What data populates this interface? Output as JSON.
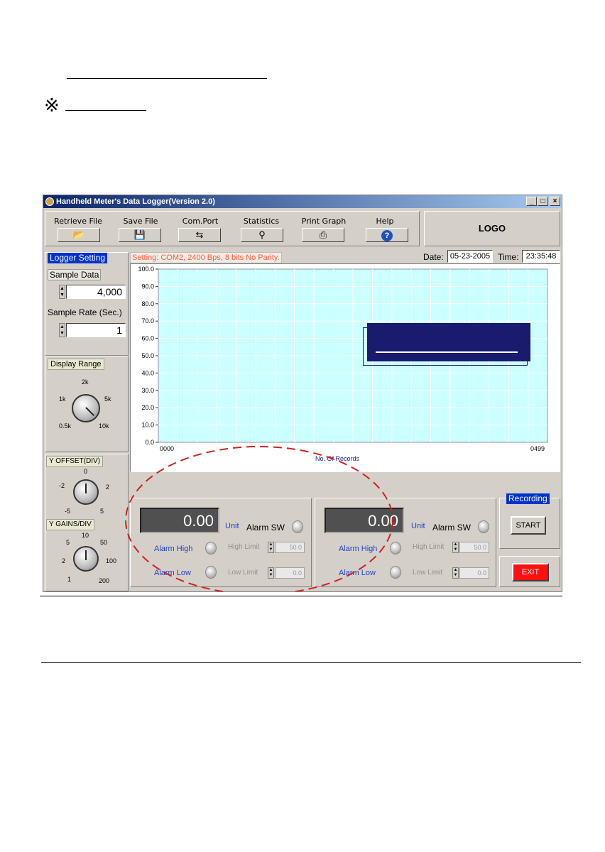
{
  "page": {
    "kome_mark": "※"
  },
  "window": {
    "title": "Handheld Meter's Data Logger(Version 2.0)",
    "controls": {
      "minimize": "_",
      "maximize": "□",
      "close": "×"
    }
  },
  "toolbar": {
    "items": [
      {
        "label": "Retrieve File",
        "icon": "📂"
      },
      {
        "label": "Save File",
        "icon": "💾"
      },
      {
        "label": "Com.Port",
        "icon": "⇆"
      },
      {
        "label": "Statistics",
        "icon": "⚲"
      },
      {
        "label": "Print Graph",
        "icon": "⎙"
      },
      {
        "label": "Help",
        "icon": "?"
      }
    ],
    "logo": "LOGO"
  },
  "status": {
    "setting": "Setting: COM2, 2400 Bps, 8 bits No Parity.",
    "date_label": "Date:",
    "date_value": "05-23-2005",
    "time_label": "Time:",
    "time_value": "23:35:48"
  },
  "logger": {
    "title": "Logger Setting",
    "sample_data_label": "Sample Data",
    "sample_data_value": "4,000",
    "sample_rate_label": "Sample Rate (Sec.)",
    "sample_rate_value": "1"
  },
  "display_range": {
    "title": "Display Range",
    "ticks": [
      "2k",
      "1k",
      "5k",
      "0.5k",
      "10k"
    ]
  },
  "y_offset": {
    "title": "Y OFFSET(DIV)",
    "ticks": [
      "0",
      "-2",
      "2",
      "-5",
      "5"
    ]
  },
  "y_gains": {
    "title": "Y GAINS/DIV",
    "ticks": [
      "10",
      "5",
      "50",
      "2",
      "100",
      "1",
      "200"
    ]
  },
  "chart_data": {
    "type": "line",
    "title": "",
    "xlabel": "No. Of Records",
    "ylabel": "",
    "x_ticks": [
      "0000",
      "0499"
    ],
    "y_ticks": [
      "100.0",
      "90.0",
      "80.0",
      "70.0",
      "60.0",
      "50.0",
      "40.0",
      "30.0",
      "20.0",
      "10.0",
      "0.0"
    ],
    "ylim": [
      0,
      100
    ],
    "grid": true,
    "series": []
  },
  "channels": [
    {
      "value": "0.00",
      "unit": "Unit",
      "alarm_sw": "Alarm SW",
      "alarm_high": "Alarm High",
      "alarm_low": "Alarm Low",
      "high_limit_label": "High Limit",
      "high_limit": "50.0",
      "low_limit_label": "Low Limit",
      "low_limit": "0.0"
    },
    {
      "value": "0.00",
      "unit": "Unit",
      "alarm_sw": "Alarm SW",
      "alarm_high": "Alarm High",
      "alarm_low": "Alarm Low",
      "high_limit_label": "High Limit",
      "high_limit": "50.0",
      "low_limit_label": "Low Limit",
      "low_limit": "0.0"
    }
  ],
  "recording": {
    "title": "Recording",
    "start": "START",
    "exit": "EXIT"
  },
  "colors": {
    "chart_bg": "#ccffff",
    "grid": "#ffffff",
    "title_blue": "#0033cc",
    "exit_red": "#ff1010",
    "overlay_navy": "#1a1a6e",
    "dash_red": "#d02020"
  }
}
